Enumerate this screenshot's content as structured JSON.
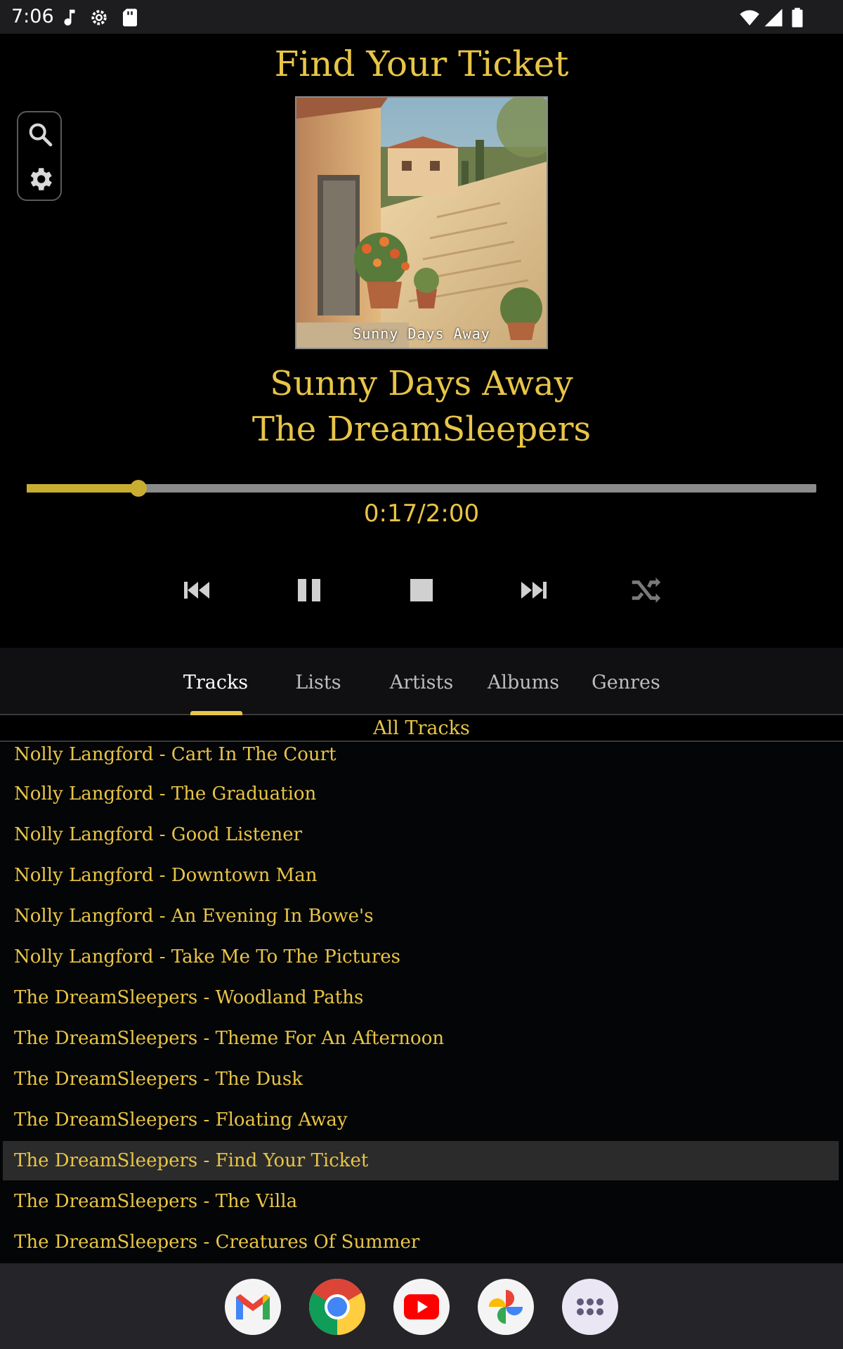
{
  "status_bar": {
    "time": "7:06",
    "left_icons": [
      "music-note-icon",
      "settings-gear-icon",
      "sd-card-icon"
    ],
    "right_icons": [
      "wifi-icon",
      "cell-signal-icon",
      "battery-icon"
    ]
  },
  "header": {
    "title": "Find Your Ticket"
  },
  "tools": [
    "search-icon",
    "gear-icon"
  ],
  "now_playing": {
    "album_caption": "Sunny Days Away",
    "song_title": "Sunny Days Away",
    "artist": "The DreamSleepers",
    "time_readout": "0:17/2:00",
    "progress_fraction": 0.1417
  },
  "transport": [
    "previous-icon",
    "pause-icon",
    "stop-icon",
    "next-icon",
    "shuffle-icon"
  ],
  "tabs": [
    {
      "label": "Tracks",
      "active": true
    },
    {
      "label": "Lists",
      "active": false
    },
    {
      "label": "Artists",
      "active": false
    },
    {
      "label": "Albums",
      "active": false
    },
    {
      "label": "Genres",
      "active": false
    }
  ],
  "list_header": "All Tracks",
  "tracks": [
    "Nolly Langford - Cart In The Court",
    "Nolly Langford - The Graduation",
    "Nolly Langford - Good Listener",
    "Nolly Langford - Downtown Man",
    "Nolly Langford - An Evening In Bowe's",
    "Nolly Langford - Take Me To The Pictures",
    "The DreamSleepers - Woodland Paths",
    "The DreamSleepers - Theme For An Afternoon",
    "The DreamSleepers - The Dusk",
    "The DreamSleepers - Floating Away",
    "The DreamSleepers - Find Your Ticket",
    "The DreamSleepers - The Villa",
    "The DreamSleepers - Creatures Of Summer"
  ],
  "current_track_index": 10,
  "dock": [
    "gmail-icon",
    "chrome-icon",
    "youtube-icon",
    "photos-icon",
    "app-drawer-icon"
  ],
  "colors": {
    "accent": "#e8c547",
    "seek_fill": "#c9ad31",
    "seek_track": "#8b8b8b",
    "background": "#000000",
    "selected_row": "#2b2b2b"
  }
}
